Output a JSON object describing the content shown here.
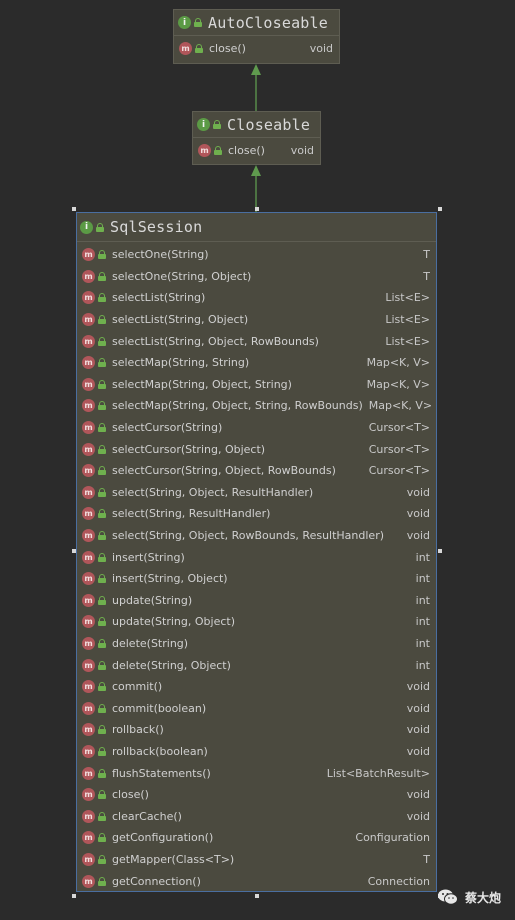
{
  "classes": {
    "auto_closeable": {
      "name": "AutoCloseable",
      "badge": "i",
      "methods": [
        {
          "name": "close()",
          "type": "void"
        }
      ]
    },
    "closeable": {
      "name": "Closeable",
      "badge": "i",
      "methods": [
        {
          "name": "close()",
          "type": "void"
        }
      ]
    },
    "sql_session": {
      "name": "SqlSession",
      "badge": "i",
      "methods": [
        {
          "name": "selectOne(String)",
          "type": "T"
        },
        {
          "name": "selectOne(String, Object)",
          "type": "T"
        },
        {
          "name": "selectList(String)",
          "type": "List<E>"
        },
        {
          "name": "selectList(String, Object)",
          "type": "List<E>"
        },
        {
          "name": "selectList(String, Object, RowBounds)",
          "type": "List<E>"
        },
        {
          "name": "selectMap(String, String)",
          "type": "Map<K, V>"
        },
        {
          "name": "selectMap(String, Object, String)",
          "type": "Map<K, V>"
        },
        {
          "name": "selectMap(String, Object, String, RowBounds)",
          "type": "Map<K, V>"
        },
        {
          "name": "selectCursor(String)",
          "type": "Cursor<T>"
        },
        {
          "name": "selectCursor(String, Object)",
          "type": "Cursor<T>"
        },
        {
          "name": "selectCursor(String, Object, RowBounds)",
          "type": "Cursor<T>"
        },
        {
          "name": "select(String, Object, ResultHandler)",
          "type": "void"
        },
        {
          "name": "select(String, ResultHandler)",
          "type": "void"
        },
        {
          "name": "select(String, Object, RowBounds, ResultHandler)",
          "type": "void"
        },
        {
          "name": "insert(String)",
          "type": "int"
        },
        {
          "name": "insert(String, Object)",
          "type": "int"
        },
        {
          "name": "update(String)",
          "type": "int"
        },
        {
          "name": "update(String, Object)",
          "type": "int"
        },
        {
          "name": "delete(String)",
          "type": "int"
        },
        {
          "name": "delete(String, Object)",
          "type": "int"
        },
        {
          "name": "commit()",
          "type": "void"
        },
        {
          "name": "commit(boolean)",
          "type": "void"
        },
        {
          "name": "rollback()",
          "type": "void"
        },
        {
          "name": "rollback(boolean)",
          "type": "void"
        },
        {
          "name": "flushStatements()",
          "type": "List<BatchResult>"
        },
        {
          "name": "close()",
          "type": "void"
        },
        {
          "name": "clearCache()",
          "type": "void"
        },
        {
          "name": "getConfiguration()",
          "type": "Configuration"
        },
        {
          "name": "getMapper(Class<T>)",
          "type": "T"
        },
        {
          "name": "getConnection()",
          "type": "Connection"
        }
      ]
    }
  },
  "relations": [
    {
      "from": "closeable",
      "to": "auto_closeable",
      "kind": "extends"
    },
    {
      "from": "sql_session",
      "to": "closeable",
      "kind": "extends"
    }
  ],
  "colors": {
    "background": "#2b2b2b",
    "node_fill": "#4b4a3f",
    "interface_badge": "#5b9a45",
    "method_badge": "#b0565a",
    "arrow": "#5f9a4e"
  },
  "icons": {
    "interface": "interface-icon",
    "method": "method-icon",
    "visibility": "public-lock-icon",
    "watermark": "wechat-icon"
  },
  "watermark": {
    "text": "蔡大炮"
  }
}
